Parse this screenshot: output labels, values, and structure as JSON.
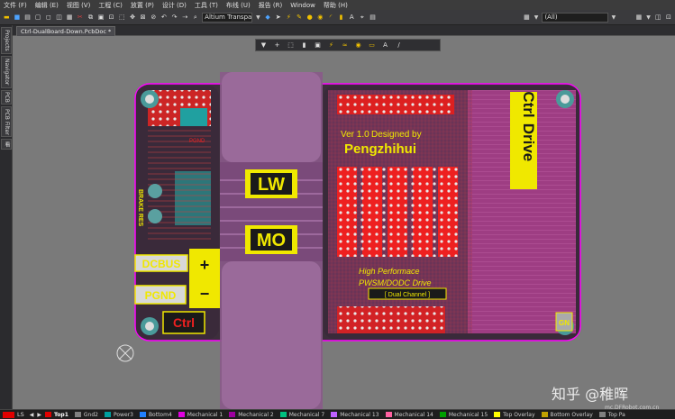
{
  "menu": [
    "文件 (F)",
    "编辑 (E)",
    "视图 (V)",
    "工程 (C)",
    "放置 (P)",
    "设计 (D)",
    "工具 (T)",
    "布线 (U)",
    "报告 (R)",
    "Window",
    "帮助 (H)"
  ],
  "toolbar": {
    "view_combo": "Altium Transparent",
    "filter_combo": "(All)"
  },
  "left_tabs": [
    "Projects",
    "Navigator",
    "PCB",
    "PCB Filter",
    "看"
  ],
  "document_tab": "Ctrl-DualBoard-Down.PcbDoc *",
  "pcb": {
    "silk_ver": "Ver 1.0",
    "silk_designed": "Designed by",
    "silk_author": "Pengzhihui",
    "silk_ctrl": "Ctrl",
    "silk_drive": "Drive",
    "silk_lw": "LW",
    "silk_mo": "MO",
    "silk_dcbus": "DCBUS",
    "silk_pgnd": "PGND",
    "silk_ctrl_bottom": "Ctrl",
    "silk_plus": "+",
    "silk_minus": "−",
    "silk_brake": "BRAKE RES",
    "silk_high_perf": "High Performace",
    "silk_pwsm": "PWSM/DODC Drive",
    "silk_dual": "[ Dual Channel ]",
    "silk_gn": "GN",
    "silk_pgnd_small": "PGND"
  },
  "layers": {
    "ls_label": "LS",
    "items": [
      {
        "name": "Top1",
        "color": "#e00000",
        "active": true
      },
      {
        "name": "Gnd2",
        "color": "#808080",
        "active": false
      },
      {
        "name": "Power3",
        "color": "#00a0a0",
        "active": false
      },
      {
        "name": "Bottom4",
        "color": "#2080ff",
        "active": false
      },
      {
        "name": "Mechanical 1",
        "color": "#e000e0",
        "active": false
      },
      {
        "name": "Mechanical 2",
        "color": "#a000a0",
        "active": false
      },
      {
        "name": "Mechanical 7",
        "color": "#00c080",
        "active": false
      },
      {
        "name": "Mechanical 13",
        "color": "#c060ff",
        "active": false
      },
      {
        "name": "Mechanical 14",
        "color": "#ff60a0",
        "active": false
      },
      {
        "name": "Mechanical 15",
        "color": "#00a000",
        "active": false
      },
      {
        "name": "Top Overlay",
        "color": "#ffff00",
        "active": false
      },
      {
        "name": "Bottom Overlay",
        "color": "#c0a000",
        "active": false
      },
      {
        "name": "Top Pa",
        "color": "#808080",
        "active": false
      }
    ]
  },
  "watermark": {
    "logo": "知乎 @稚晖",
    "url": "mc.DFRobot.com.cn"
  }
}
